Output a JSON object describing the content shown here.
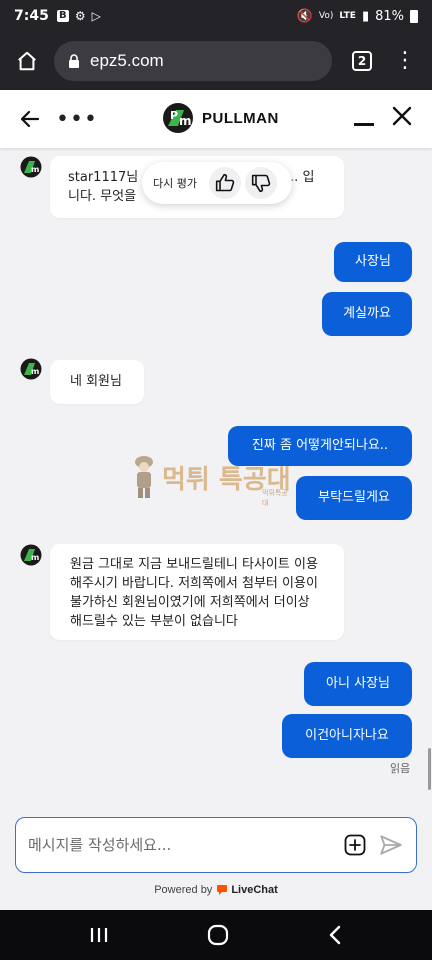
{
  "status_bar": {
    "time": "7:45",
    "network": "LTE",
    "signal_text": "Vo)",
    "battery": "81%"
  },
  "browser": {
    "url": "epz5.com",
    "tab_count": "2"
  },
  "chat_header": {
    "brand": "PULLMAN"
  },
  "rating_popup": {
    "label": "다시 평가"
  },
  "messages": [
    {
      "from": "agent",
      "text": "star1117님 ……………………………… 입니다. 무엇을"
    },
    {
      "from": "user",
      "text": "사장님"
    },
    {
      "from": "user",
      "text": "계실까요"
    },
    {
      "from": "agent",
      "text": "네 회원님"
    },
    {
      "from": "user",
      "text": "진짜 좀 어떻게안되나요.."
    },
    {
      "from": "user",
      "text": "부탁드릴게요"
    },
    {
      "from": "agent",
      "text": "원금 그대로 지금 보내드릴테니 타사이트 이용 해주시기 바랍니다. 저희쪽에서 첨부터 이용이 불가하신 회원님이였기에 저희쪽에서 더이상 해드릴수 있는 부분이 없습니다"
    },
    {
      "from": "user",
      "text": "아니 사장님"
    },
    {
      "from": "user",
      "text": "이건아니자나요"
    }
  ],
  "read_receipt": "읽음",
  "watermark": {
    "text": "먹튀 특공대",
    "sub": "먹튀특공대"
  },
  "composer": {
    "placeholder": "메시지를 작성하세요..."
  },
  "footer": {
    "powered_by": "Powered by",
    "brand": "LiveChat"
  },
  "colors": {
    "user_bubble": "#0b5fd9",
    "agent_logo_green": "#3bb54a",
    "header_bg": "#232328"
  }
}
